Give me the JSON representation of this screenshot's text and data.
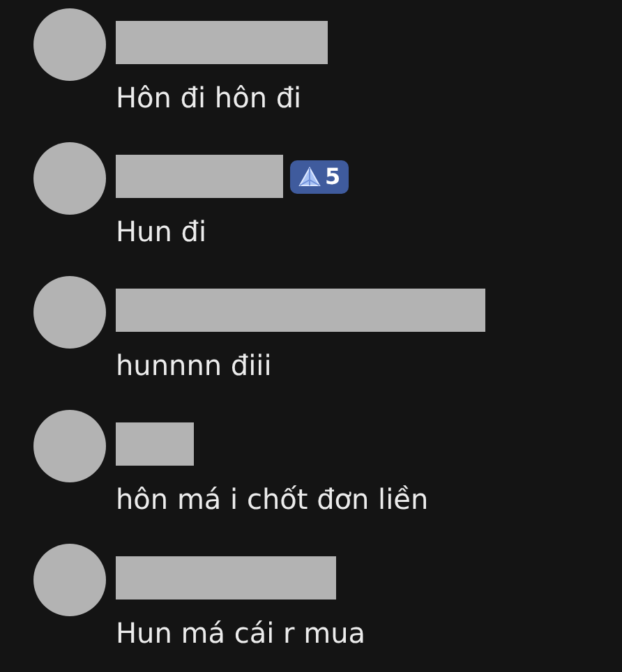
{
  "comments": [
    {
      "message": "Hôn đi hôn đi"
    },
    {
      "message": "Hun đi",
      "badge": {
        "text": "5"
      }
    },
    {
      "message": "hunnnn điii"
    },
    {
      "message": "hôn má i chốt đơn liền"
    },
    {
      "message": "Hun má cái r mua"
    }
  ]
}
